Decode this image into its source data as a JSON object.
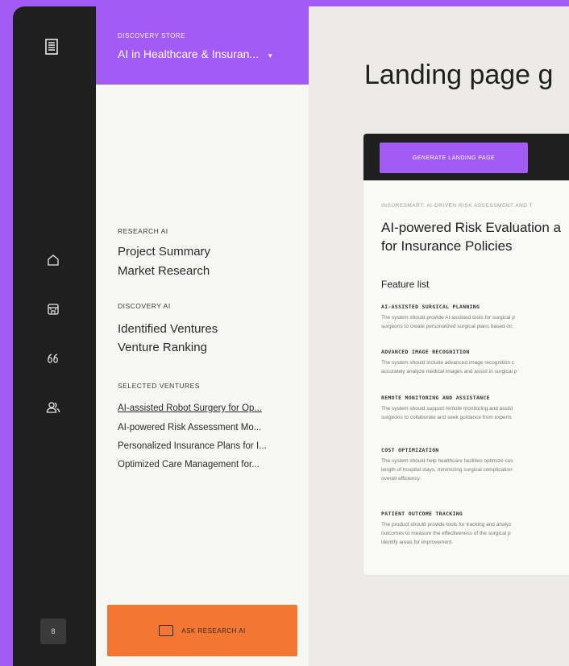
{
  "rail": {
    "version_badge": "8"
  },
  "store": {
    "label": "DISCOVERY STORE",
    "name": "AI in Healthcare & Insuran...",
    "caret": "▾"
  },
  "research_ai": {
    "label": "RESEARCH AI",
    "items": [
      "Project Summary",
      "Market Research"
    ]
  },
  "discovery_ai": {
    "label": "DISCOVERY AI",
    "items": [
      "Identified Ventures",
      "Venture Ranking"
    ]
  },
  "selected_ventures": {
    "label": "SELECTED VENTURES",
    "items": [
      "AI-assisted Robot Surgery for Op...",
      "AI-powered Risk Assessment Mo...",
      "Personalized Insurance Plans for I...",
      "Optimized Care Management for..."
    ]
  },
  "ask_button": "ASK RESEARCH AI",
  "page_title": "Landing page g",
  "card": {
    "generate_button": "GENERATE LANDING PAGE",
    "breadcrumb": "INSURESMART: AI-DRIVEN RISK ASSESSMENT AND T",
    "heading_line1": "AI-powered Risk Evaluation a",
    "heading_line2": "for Insurance Policies",
    "feature_list_label": "Feature list",
    "features": [
      {
        "title": "AI-ASSISTED SURGICAL PLANNING",
        "desc": [
          "The system should provide AI-assisted tools for surgical p",
          "surgeons to create personalized surgical plans based on"
        ]
      },
      {
        "title": "ADVANCED IMAGE RECOGNITION",
        "desc": [
          "The system should include advanced image recognition c",
          "accurately analyze medical images and assist in surgical p"
        ]
      },
      {
        "title": "REMOTE MONITORING AND ASSISTANCE",
        "desc": [
          "The system should support remote monitoring and assist",
          "surgeons to collaborate and seek guidance from experts"
        ]
      },
      {
        "title": "COST OPTIMIZATION",
        "desc": [
          "The system should help healthcare facilities optimize cos",
          "length of hospital stays, minimizing surgical complication",
          "overall efficiency."
        ]
      },
      {
        "title": "PATIENT OUTCOME TRACKING",
        "desc": [
          "The product should provide tools for tracking and analyz",
          "outcomes to measure the effectiveness of the surgical p",
          "identify areas for improvement."
        ]
      }
    ]
  }
}
